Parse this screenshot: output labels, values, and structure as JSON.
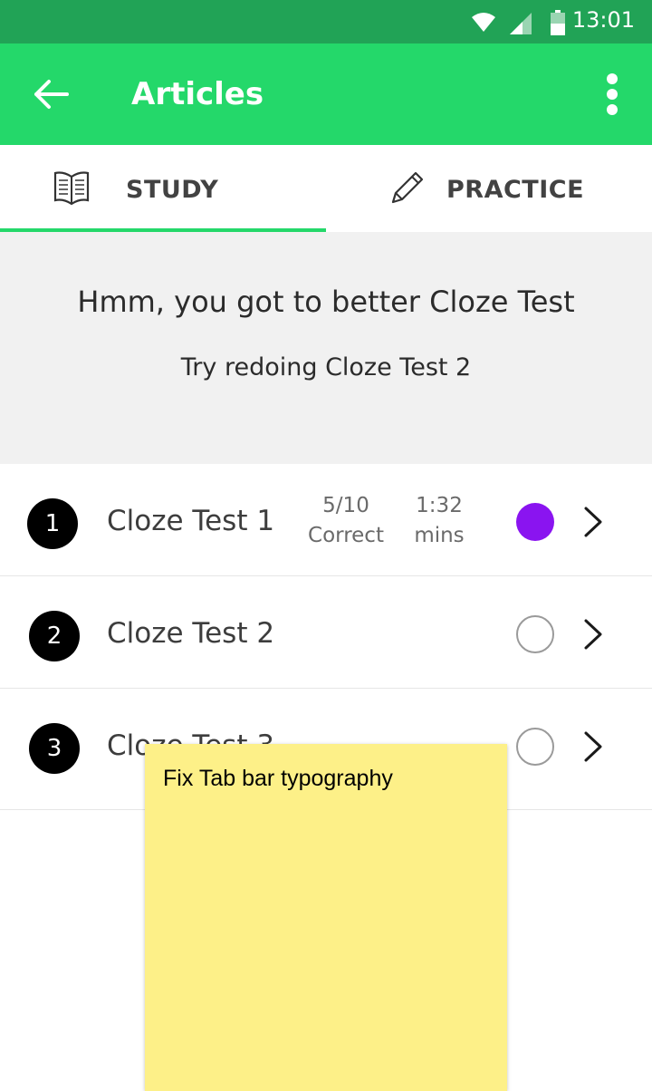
{
  "status_bar": {
    "time": "13:01",
    "icons": [
      "wifi-icon",
      "cell-signal-icon",
      "battery-icon"
    ]
  },
  "app_bar": {
    "title": "Articles",
    "back_icon": "arrow-left-icon",
    "menu_icon": "more-vertical-icon"
  },
  "tabs": [
    {
      "label": "STUDY",
      "icon": "book-icon",
      "selected": true
    },
    {
      "label": "PRACTICE",
      "icon": "pencil-icon",
      "selected": false
    }
  ],
  "feedback": {
    "headline": "Hmm, you got to better Cloze Test",
    "subtitle": "Try redoing Cloze Test 2"
  },
  "tests": [
    {
      "number": "1",
      "name": "Cloze Test 1",
      "score_value": "5/10",
      "score_unit": "Correct",
      "time_value": "1:32",
      "time_unit": "mins",
      "completed": true
    },
    {
      "number": "2",
      "name": "Cloze Test 2",
      "completed": false
    },
    {
      "number": "3",
      "name": "Cloze Test 3",
      "completed": false
    }
  ],
  "sticky_note": {
    "text": "Fix Tab bar typography"
  },
  "colors": {
    "status_bar": "#21a356",
    "app_bar": "#24d86a",
    "accent": "#24d86a",
    "completed_dot": "#8a14f0",
    "sticky_note": "#fdf088"
  }
}
